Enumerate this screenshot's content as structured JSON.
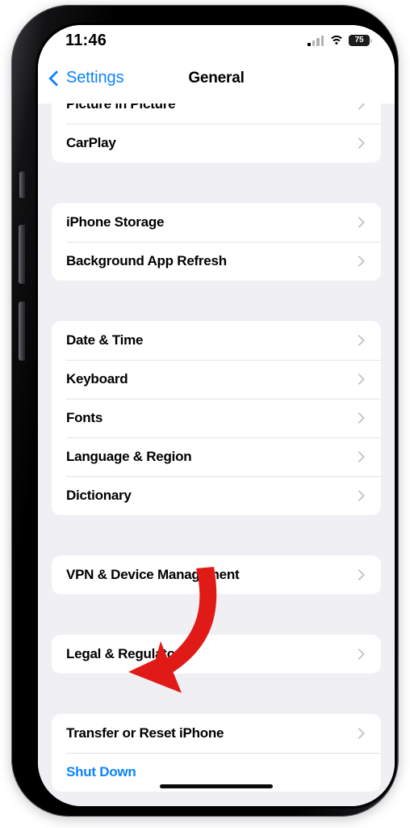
{
  "device": {
    "kind": "iphone-frame",
    "frame_color": "#000000",
    "screen_bg": "#efeff4"
  },
  "status_bar": {
    "time": "11:46",
    "signal_icon": "cellular-signal-icon",
    "signal_bars_filled": 1,
    "signal_bars_total": 4,
    "wifi_icon": "wifi-icon",
    "battery_icon": "battery-icon",
    "battery_percent": "75"
  },
  "nav_bar": {
    "back_icon": "chevron-left-icon",
    "back_label": "Settings",
    "title": "General"
  },
  "accent_color": "#0a84ff",
  "annotation": {
    "type": "curved-arrow",
    "color": "#e01b17",
    "points_to": "Shut Down"
  },
  "sections": [
    {
      "id": "media",
      "clipped_top": true,
      "rows": [
        {
          "label": "Picture in Picture",
          "accessory": "chevron-right-icon",
          "style": "default"
        },
        {
          "label": "CarPlay",
          "accessory": "chevron-right-icon",
          "style": "default"
        }
      ]
    },
    {
      "id": "storage",
      "clipped_top": false,
      "rows": [
        {
          "label": "iPhone Storage",
          "accessory": "chevron-right-icon",
          "style": "default"
        },
        {
          "label": "Background App Refresh",
          "accessory": "chevron-right-icon",
          "style": "default"
        }
      ]
    },
    {
      "id": "locale",
      "clipped_top": false,
      "rows": [
        {
          "label": "Date & Time",
          "accessory": "chevron-right-icon",
          "style": "default"
        },
        {
          "label": "Keyboard",
          "accessory": "chevron-right-icon",
          "style": "default"
        },
        {
          "label": "Fonts",
          "accessory": "chevron-right-icon",
          "style": "default"
        },
        {
          "label": "Language & Region",
          "accessory": "chevron-right-icon",
          "style": "default"
        },
        {
          "label": "Dictionary",
          "accessory": "chevron-right-icon",
          "style": "default"
        }
      ]
    },
    {
      "id": "management",
      "clipped_top": false,
      "rows": [
        {
          "label": "VPN & Device Management",
          "accessory": "chevron-right-icon",
          "style": "default"
        }
      ]
    },
    {
      "id": "legal",
      "clipped_top": false,
      "rows": [
        {
          "label": "Legal & Regulatory",
          "accessory": "chevron-right-icon",
          "style": "default"
        }
      ]
    },
    {
      "id": "reset",
      "clipped_top": false,
      "rows": [
        {
          "label": "Transfer or Reset iPhone",
          "accessory": "chevron-right-icon",
          "style": "default"
        },
        {
          "label": "Shut Down",
          "accessory": "none",
          "style": "link"
        }
      ]
    }
  ],
  "home_indicator": "home-indicator"
}
